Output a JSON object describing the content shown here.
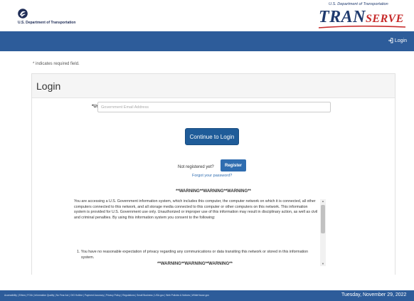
{
  "header": {
    "agency_name": "U.S. Department of Transportation",
    "brand_subtitle": "U.S. Department of Transportation",
    "brand_tran": "TRAN",
    "brand_serve": "SERVE"
  },
  "nav": {
    "login_label": "Login",
    "login_icon": "sign-in-icon"
  },
  "form": {
    "required_note": "* indicates required field.",
    "title": "Login",
    "username_label": "*User Name:",
    "username_placeholder": "Government Email Address",
    "username_value": "",
    "continue_label": "Continue to Login",
    "not_registered": "Not registered yet?",
    "register_label": "Register",
    "forgot_label": "Forgot your password?"
  },
  "warning": {
    "title": "**WARNING**WARNING**WARNING**",
    "body": "You are accessing a U.S. Government information system, which includes this computer, the computer network on which it is connected, all other computers connected to this network, and all storage media connected to this computer or other computers on this network. This information system is provided for U.S. Government use only. Unauthorized or improper use of this information may result in disciplinary action, as well as civil and criminal penalties. By using this information system you consent to the following:",
    "items": [
      "1. You have no reasonable expectation of privacy regarding any communications or data transiting this network or stored in this information system."
    ],
    "footer": "**WARNING**WARNING**WARNING**"
  },
  "footer": {
    "links": "Accessibility | Ethics | FOIA | Information Quality | No Fear Act | OIG Hotline | Payment Accuracy | Privacy Policy | Regulations | Small Business | USA.gov | Web Policies & Notices | WhiteHouse.gov",
    "date": "Tuesday, November 29, 2022"
  },
  "colors": {
    "nav_blue": "#2d5c9a",
    "button_blue": "#1f5c99",
    "brand_red": "#c62828",
    "brand_navy": "#1f3a6e"
  }
}
